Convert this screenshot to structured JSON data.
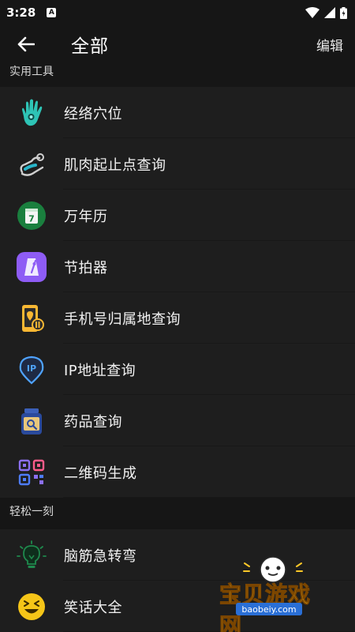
{
  "status_bar": {
    "time": "3:28",
    "notification_badge": "A"
  },
  "toolbar": {
    "title": "全部",
    "edit_label": "编辑"
  },
  "sections": [
    {
      "title": "实用工具",
      "items": [
        {
          "label": "经络穴位",
          "icon": "hand-acupoint-icon"
        },
        {
          "label": "肌肉起止点查询",
          "icon": "arm-muscle-icon"
        },
        {
          "label": "万年历",
          "icon": "calendar-icon"
        },
        {
          "label": "节拍器",
          "icon": "metronome-icon"
        },
        {
          "label": "手机号归属地查询",
          "icon": "phone-location-icon"
        },
        {
          "label": "IP地址查询",
          "icon": "ip-location-icon"
        },
        {
          "label": "药品查询",
          "icon": "medicine-jar-icon"
        },
        {
          "label": "二维码生成",
          "icon": "qr-code-icon"
        }
      ]
    },
    {
      "title": "轻松一刻",
      "items": [
        {
          "label": "脑筋急转弯",
          "icon": "lightbulb-icon"
        },
        {
          "label": "笑话大全",
          "icon": "laughing-face-icon"
        }
      ]
    }
  ],
  "calendar_icon_day": "7",
  "ip_icon_text": "IP",
  "watermark": {
    "text": "宝贝游戏网",
    "url": "baobeiy.com"
  }
}
